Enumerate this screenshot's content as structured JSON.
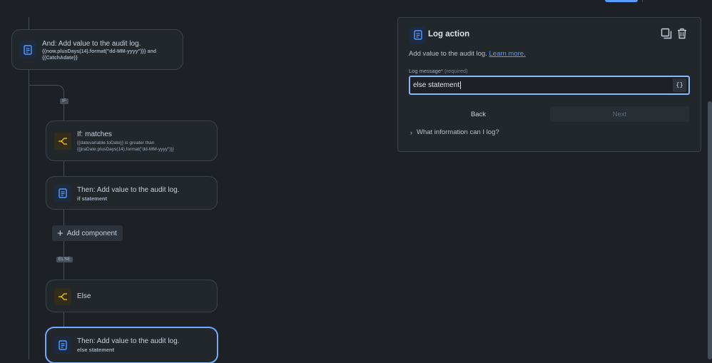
{
  "flow": {
    "and_card": {
      "title": "And: Add value to the audit log.",
      "line1": "{{now.plusDays(14).format(\"dd-MM-yyyy\")}} and",
      "line2": "{{CatchAdate}}"
    },
    "if_pill": "IF",
    "if_card": {
      "title": "If: matches",
      "line1": "{{datevariable.toDate}} is greater than",
      "line2": "{{jiraDate.plusDays(14).format(\"dd-MM-yyyy\")}}"
    },
    "then_if_card": {
      "title": "Then: Add value to the audit log.",
      "sub": "if statement"
    },
    "add_component_label": "Add component",
    "else_pill": "ELSE",
    "else_card": {
      "title": "Else"
    },
    "then_else_card": {
      "title": "Then: Add value to the audit log.",
      "sub": "else statement"
    }
  },
  "panel": {
    "title": "Log action",
    "description": "Add value to the audit log.",
    "learn_more": "Learn more.",
    "field_label": "Log message",
    "required_star": "*",
    "required_hint": "(required)",
    "input_value": "else statement",
    "smart_values_button": "{}",
    "back_label": "Back",
    "next_label": "Next",
    "expander_label": "What information can I log?"
  },
  "colors": {
    "background": "#1d2125",
    "card": "#22272b",
    "accent": "#579dff",
    "log_icon": "#579dff",
    "branch_icon": "#e2b203"
  }
}
